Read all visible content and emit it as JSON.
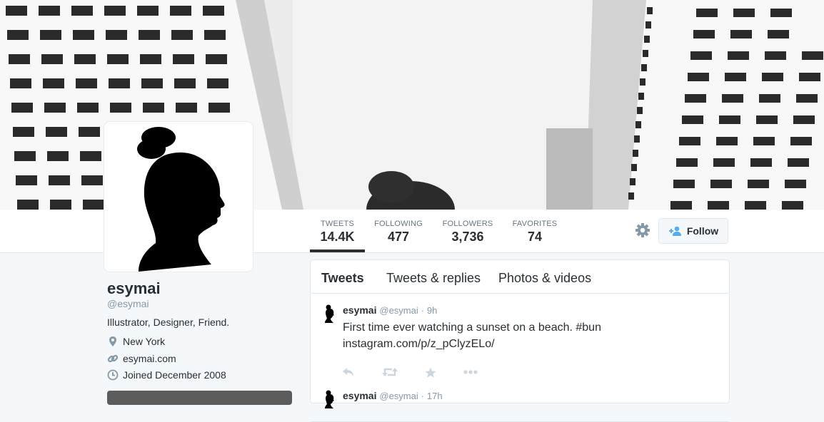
{
  "profile_nav": {
    "stats": [
      {
        "label": "TWEETS",
        "value": "14.4K",
        "active": true
      },
      {
        "label": "FOLLOWING",
        "value": "477",
        "active": false
      },
      {
        "label": "FOLLOWERS",
        "value": "3,736",
        "active": false
      },
      {
        "label": "FAVORITES",
        "value": "74",
        "active": false
      }
    ],
    "follow_label": "Follow"
  },
  "profile": {
    "name": "esymai",
    "handle": "@esymai",
    "bio": "Illustrator, Designer, Friend.",
    "location": "New York",
    "website": "esymai.com",
    "joined": "Joined December 2008"
  },
  "timeline": {
    "tabs": [
      {
        "label": "Tweets",
        "active": true
      },
      {
        "label": "Tweets & replies",
        "active": false
      },
      {
        "label": "Photos & videos",
        "active": false
      }
    ],
    "tweets": [
      {
        "name": "esymai",
        "handle": "@esymai",
        "time": "9h",
        "text": "First time ever watching a sunset on a beach. #bun instagram.com/p/z_pClyzELo/"
      },
      {
        "name": "esymai",
        "handle": "@esymai",
        "time": "17h",
        "text": ""
      }
    ]
  },
  "icons": {
    "settings": "gear-icon",
    "follow": "add-user-icon",
    "location": "location-pin-icon",
    "website": "link-icon",
    "joined": "calendar-icon",
    "reply": "reply-icon",
    "retweet": "retweet-icon",
    "favorite": "star-icon",
    "more": "more-icon"
  },
  "colors": {
    "accent": "#55acee",
    "muted": "#8899a6",
    "text": "#292f33"
  }
}
